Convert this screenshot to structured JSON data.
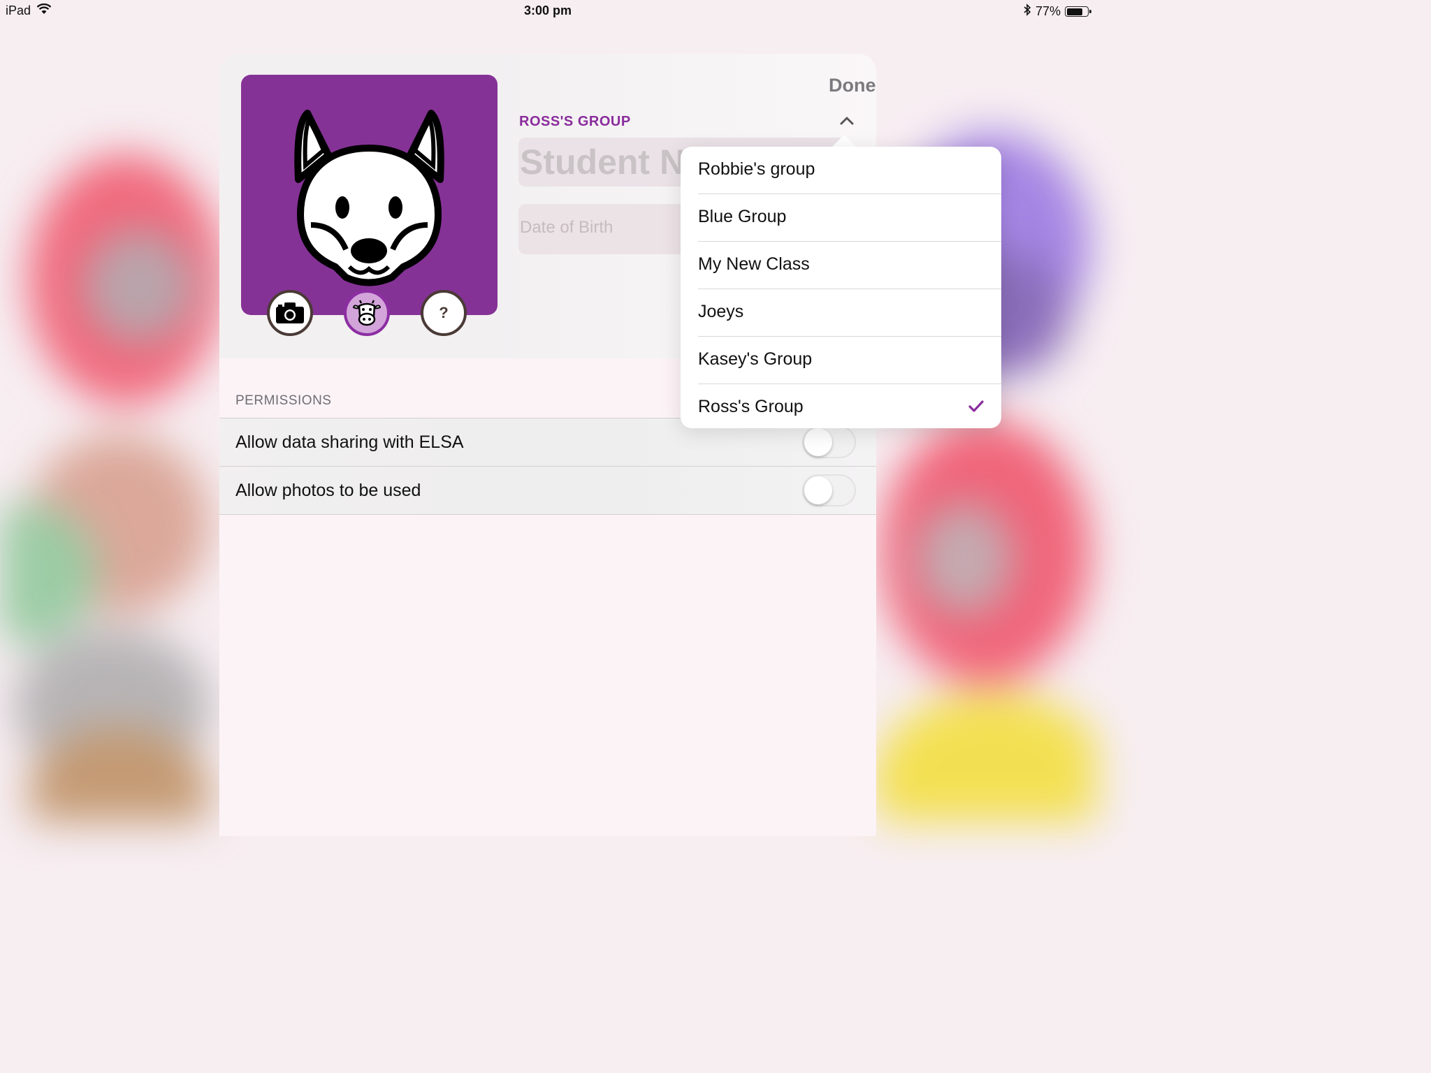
{
  "status_bar": {
    "device": "iPad",
    "time": "3:00 pm",
    "battery_percent": "77%",
    "battery_level": 0.77,
    "icons": [
      "wifi-icon",
      "bluetooth-icon",
      "battery-icon"
    ]
  },
  "colors": {
    "accent": "#853296",
    "accent_text": "#8a2c9c",
    "avatar_bg": "#853296"
  },
  "header": {
    "done_label": "Done",
    "group_label": "ROSS'S GROUP",
    "name_placeholder": "Student Name",
    "dob_placeholder": "Date of Birth"
  },
  "avatar": {
    "icon": "fox-face-icon",
    "buttons": [
      {
        "icon": "camera-icon"
      },
      {
        "icon": "cow-icon",
        "active": true
      },
      {
        "icon": "question-icon",
        "label": "?"
      }
    ]
  },
  "permissions": {
    "header": "PERMISSIONS",
    "rows": [
      {
        "label": "Allow data sharing with ELSA",
        "enabled": false
      },
      {
        "label": "Allow photos to be used",
        "enabled": false
      }
    ]
  },
  "group_popover": {
    "items": [
      {
        "label": "Robbie's group",
        "selected": false
      },
      {
        "label": "Blue Group",
        "selected": false
      },
      {
        "label": "My New Class",
        "selected": false
      },
      {
        "label": "Joeys",
        "selected": false
      },
      {
        "label": "Kasey's Group",
        "selected": false
      },
      {
        "label": "Ross's Group",
        "selected": true
      }
    ]
  }
}
